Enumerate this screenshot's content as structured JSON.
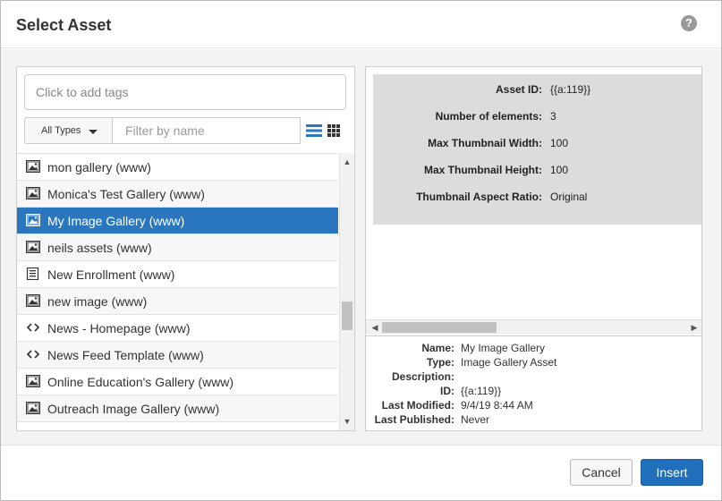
{
  "dialog": {
    "title": "Select Asset",
    "help_icon": "?"
  },
  "search": {
    "tags_placeholder": "Click to add tags",
    "type_filter": "All Types",
    "name_placeholder": "Filter by name"
  },
  "asset_list": [
    {
      "label": "mon gallery (www)",
      "icon": "image-icon"
    },
    {
      "label": "Monica's Test Gallery (www)",
      "icon": "image-icon"
    },
    {
      "label": "My Image Gallery (www)",
      "icon": "image-icon",
      "selected": true
    },
    {
      "label": "neils assets (www)",
      "icon": "image-icon"
    },
    {
      "label": "New Enrollment (www)",
      "icon": "form-icon"
    },
    {
      "label": "new image (www)",
      "icon": "image-icon"
    },
    {
      "label": "News - Homepage (www)",
      "icon": "code-icon"
    },
    {
      "label": "News Feed Template (www)",
      "icon": "code-icon"
    },
    {
      "label": "Online Education's Gallery (www)",
      "icon": "image-icon"
    },
    {
      "label": "Outreach Image Gallery (www)",
      "icon": "image-icon"
    }
  ],
  "preview": {
    "rows": [
      {
        "label": "Asset ID:",
        "value": "{{a:119}}"
      },
      {
        "label": "Number of elements:",
        "value": "3"
      },
      {
        "label": "Max Thumbnail Width:",
        "value": "100"
      },
      {
        "label": "Max Thumbnail Height:",
        "value": "100"
      },
      {
        "label": "Thumbnail Aspect Ratio:",
        "value": "Original"
      }
    ]
  },
  "details": {
    "rows": [
      {
        "label": "Name:",
        "value": "My Image Gallery"
      },
      {
        "label": "Type:",
        "value": "Image Gallery Asset"
      },
      {
        "label": "Description:",
        "value": ""
      },
      {
        "label": "ID:",
        "value": "{{a:119}}"
      },
      {
        "label": "Last Modified:",
        "value": "9/4/19 8:44 AM"
      },
      {
        "label": "Last Published:",
        "value": "Never"
      }
    ]
  },
  "footer": {
    "cancel_label": "Cancel",
    "insert_label": "Insert"
  },
  "colors": {
    "selected_row": "#2a77c0",
    "primary_button": "#1f6fbd",
    "preview_panel": "#dcdcdc"
  }
}
